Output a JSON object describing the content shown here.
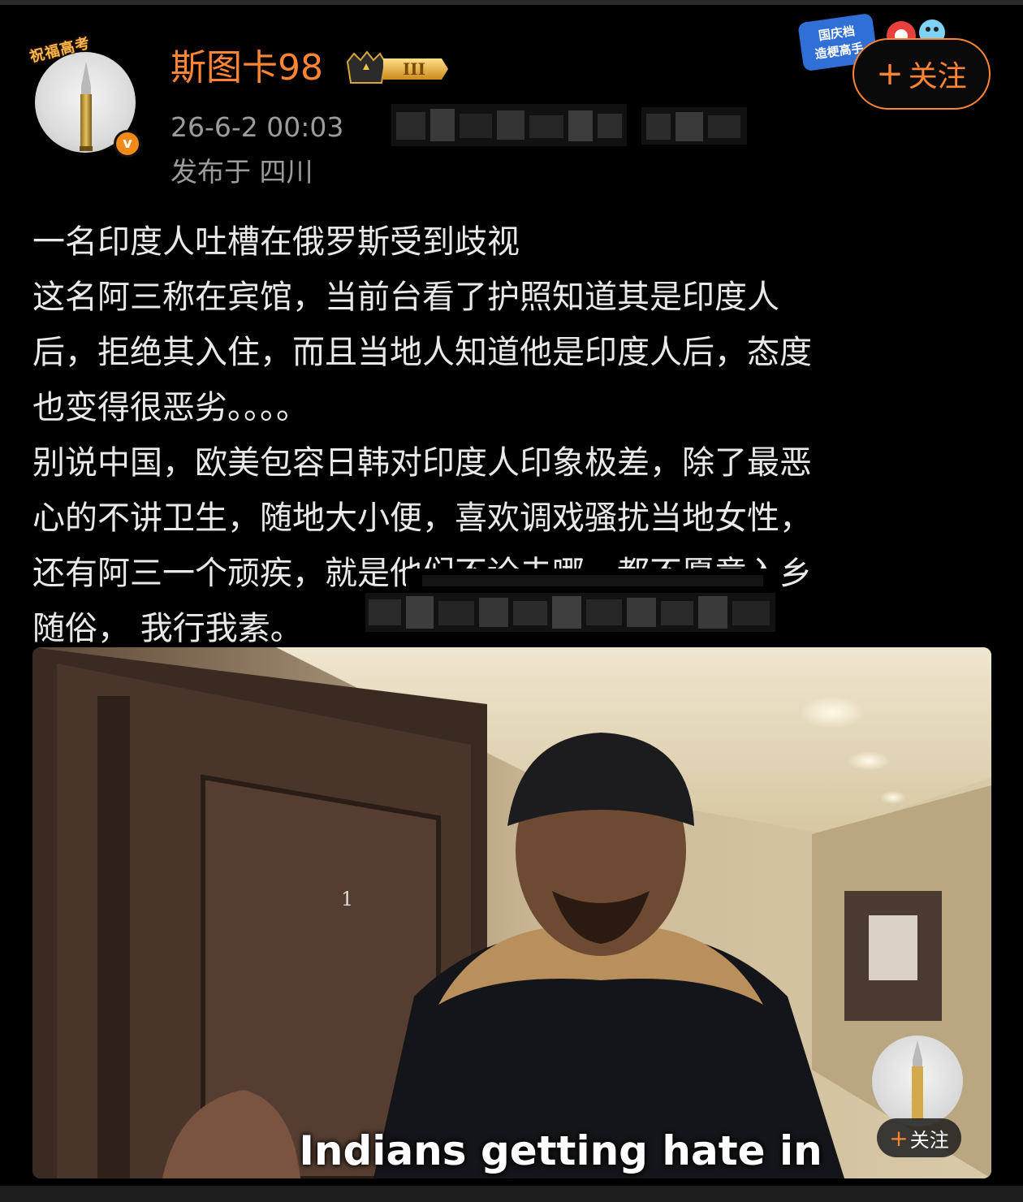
{
  "header": {
    "avatar_frame_text": "祝福高考",
    "verified_mark": "v",
    "username": "斯图卡98",
    "rank_label": "III",
    "timestamp": "26-6-2 00:03",
    "location": "发布于 四川",
    "festival_badge_line1": "国庆档",
    "festival_badge_line2": "造梗高手",
    "follow_plus": "+",
    "follow_label": "关注"
  },
  "post": {
    "lines": [
      "一名印度人吐槽在俄罗斯受到歧视",
      "这名阿三称在宾馆，当前台看了护照知道其是印度人",
      "后，拒绝其入住，而且当地人知道他是印度人后，态度",
      "也变得很恶劣。。。。",
      "别说中国，欧美包容日韩对印度人印象极差，除了最恶",
      "心的不讲卫生，随地大小便，喜欢调戏骚扰当地女性，",
      "还有阿三一个顽疾，就是他们不论去哪，都不愿意入乡",
      "随俗， 我行我素。"
    ]
  },
  "video": {
    "door_number": "1",
    "caption": "Indians getting hate in",
    "follow_plus": "+",
    "follow_label": "关注"
  },
  "colors": {
    "background": "#000000",
    "accent": "#ff8433",
    "text_primary": "#e9e9e9",
    "text_secondary": "#9c9c9c"
  },
  "icons": [
    "verified-icon",
    "crown-rank-icon",
    "plus-icon"
  ]
}
